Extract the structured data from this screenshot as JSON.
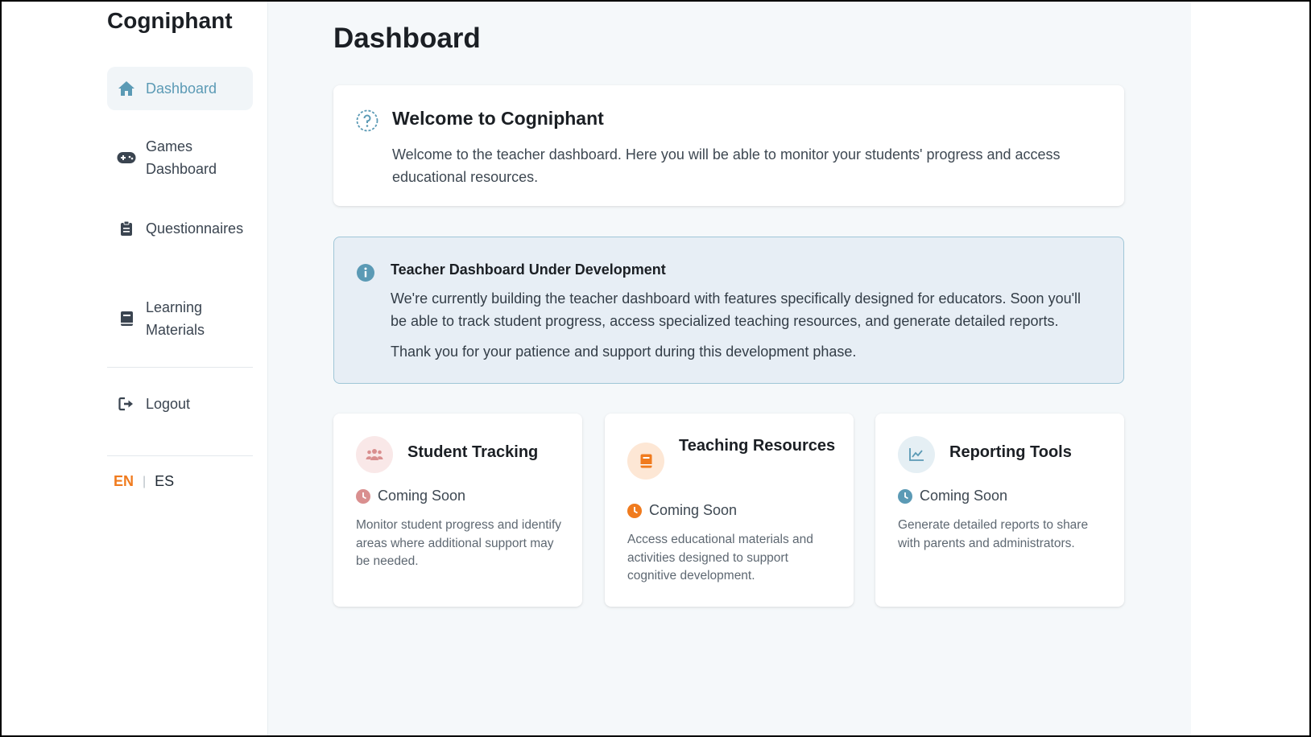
{
  "brand": "Cogniphant",
  "sidebar": {
    "items": [
      {
        "label": "Dashboard",
        "icon": "home-icon",
        "active": true
      },
      {
        "label": "Games Dashboard",
        "icon": "gamepad-icon"
      },
      {
        "label": "Questionnaires",
        "icon": "clipboard-icon"
      },
      {
        "label": "Learning Materials",
        "icon": "book-icon"
      }
    ],
    "logout": {
      "label": "Logout",
      "icon": "logout-icon"
    },
    "languages": {
      "en": "EN",
      "separator": "|",
      "es": "ES",
      "selected": "EN"
    }
  },
  "main": {
    "title": "Dashboard",
    "welcome": {
      "title": "Welcome to Cogniphant",
      "text": "Welcome to the teacher dashboard. Here you will be able to monitor your students' progress and access educational resources.",
      "icon": "question-circle-icon"
    },
    "notice": {
      "title": "Teacher Dashboard Under Development",
      "text1": "We're currently building the teacher dashboard with features specifically designed for educators. Soon you'll be able to track student progress, access specialized teaching resources, and generate detailed reports.",
      "text2": "Thank you for your patience and support during this development phase.",
      "icon": "info-icon"
    },
    "features": [
      {
        "title": "Student Tracking",
        "status": "Coming Soon",
        "description": "Monitor student progress and identify areas where additional support may be needed.",
        "icon": "users-icon",
        "color": "#d98f8f"
      },
      {
        "title": "Teaching Resources",
        "status": "Coming Soon",
        "description": "Access educational materials and activities designed to support cognitive development.",
        "icon": "book-icon",
        "color": "#f07b1e"
      },
      {
        "title": "Reporting Tools",
        "status": "Coming Soon",
        "description": "Generate detailed reports to share with parents and administrators.",
        "icon": "chart-line-icon",
        "color": "#5b9ab5"
      }
    ]
  },
  "colors": {
    "accent": "#5b9ab5",
    "orange": "#f07b1e",
    "pink": "#d98f8f"
  }
}
